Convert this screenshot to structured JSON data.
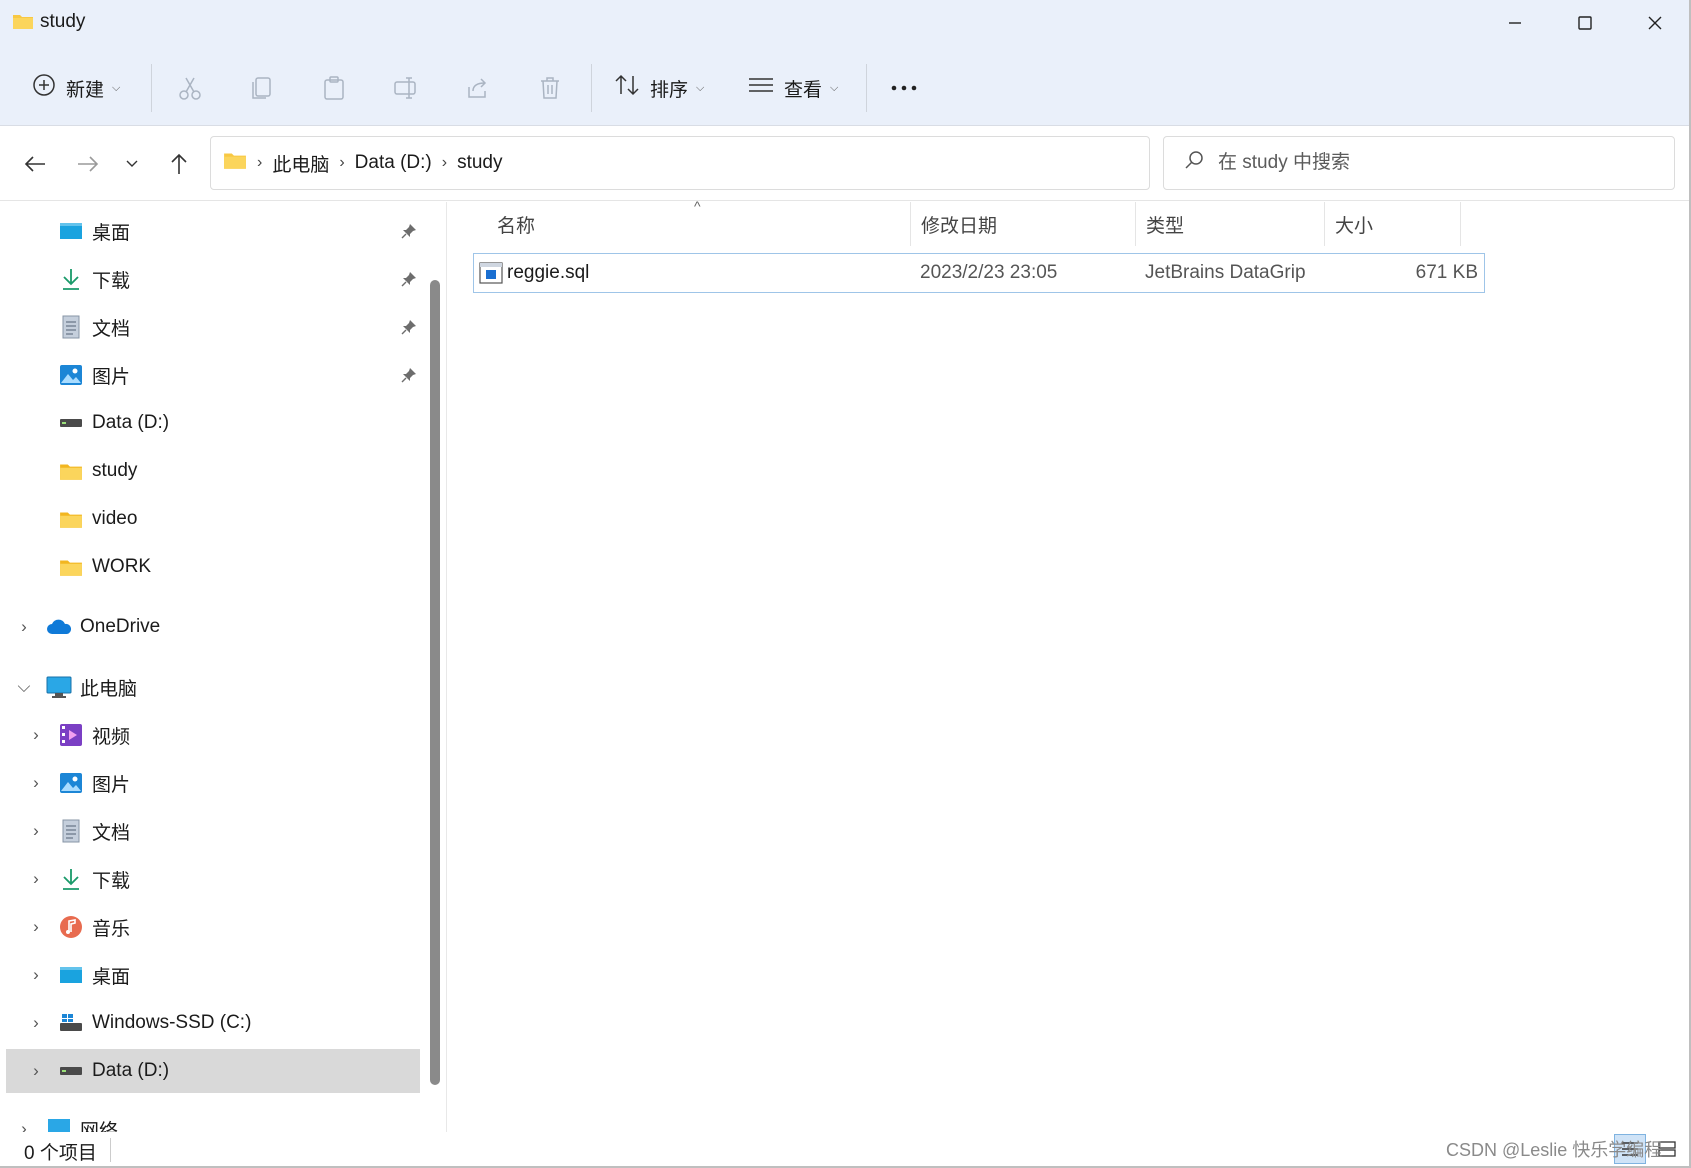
{
  "window": {
    "title": "study"
  },
  "commandbar": {
    "new_label": "新建",
    "sort_label": "排序",
    "view_label": "查看",
    "more_label": "..."
  },
  "address": {
    "crumbs": [
      "此电脑",
      "Data (D:)",
      "study"
    ]
  },
  "search": {
    "placeholder": "在 study 中搜索"
  },
  "sidebar": {
    "quick_access": [
      {
        "label": "桌面",
        "icon": "desktop-icon",
        "pinned": true
      },
      {
        "label": "下载",
        "icon": "download-icon",
        "pinned": true
      },
      {
        "label": "文档",
        "icon": "documents-icon",
        "pinned": true
      },
      {
        "label": "图片",
        "icon": "pictures-icon",
        "pinned": true
      },
      {
        "label": "Data (D:)",
        "icon": "drive-icon",
        "pinned": false
      },
      {
        "label": "study",
        "icon": "folder-icon",
        "pinned": false
      },
      {
        "label": "video",
        "icon": "folder-icon",
        "pinned": false
      },
      {
        "label": "WORK",
        "icon": "folder-icon",
        "pinned": false
      }
    ],
    "onedrive": "OneDrive",
    "this_pc": "此电脑",
    "this_pc_items": [
      {
        "label": "视频",
        "icon": "videos-icon"
      },
      {
        "label": "图片",
        "icon": "pictures-icon"
      },
      {
        "label": "文档",
        "icon": "documents-icon"
      },
      {
        "label": "下载",
        "icon": "download-icon"
      },
      {
        "label": "音乐",
        "icon": "music-icon"
      },
      {
        "label": "桌面",
        "icon": "desktop-icon"
      },
      {
        "label": "Windows-SSD (C:)",
        "icon": "windows-drive-icon"
      },
      {
        "label": "Data (D:)",
        "icon": "drive-icon",
        "selected": true
      }
    ],
    "network": "网络"
  },
  "columns": {
    "name": "名称",
    "modified": "修改日期",
    "type": "类型",
    "size": "大小"
  },
  "files": [
    {
      "name": "reggie.sql",
      "modified": "2023/2/23 23:05",
      "type": "JetBrains DataGrip",
      "size": "671 KB"
    }
  ],
  "status": {
    "count": "0 个项目"
  },
  "watermark": "CSDN @Leslie 快乐学编程",
  "colors": {
    "titlebar_bg": "#eaf0fa",
    "selection_border": "#9fc5e8",
    "folder": "#f8c843"
  }
}
